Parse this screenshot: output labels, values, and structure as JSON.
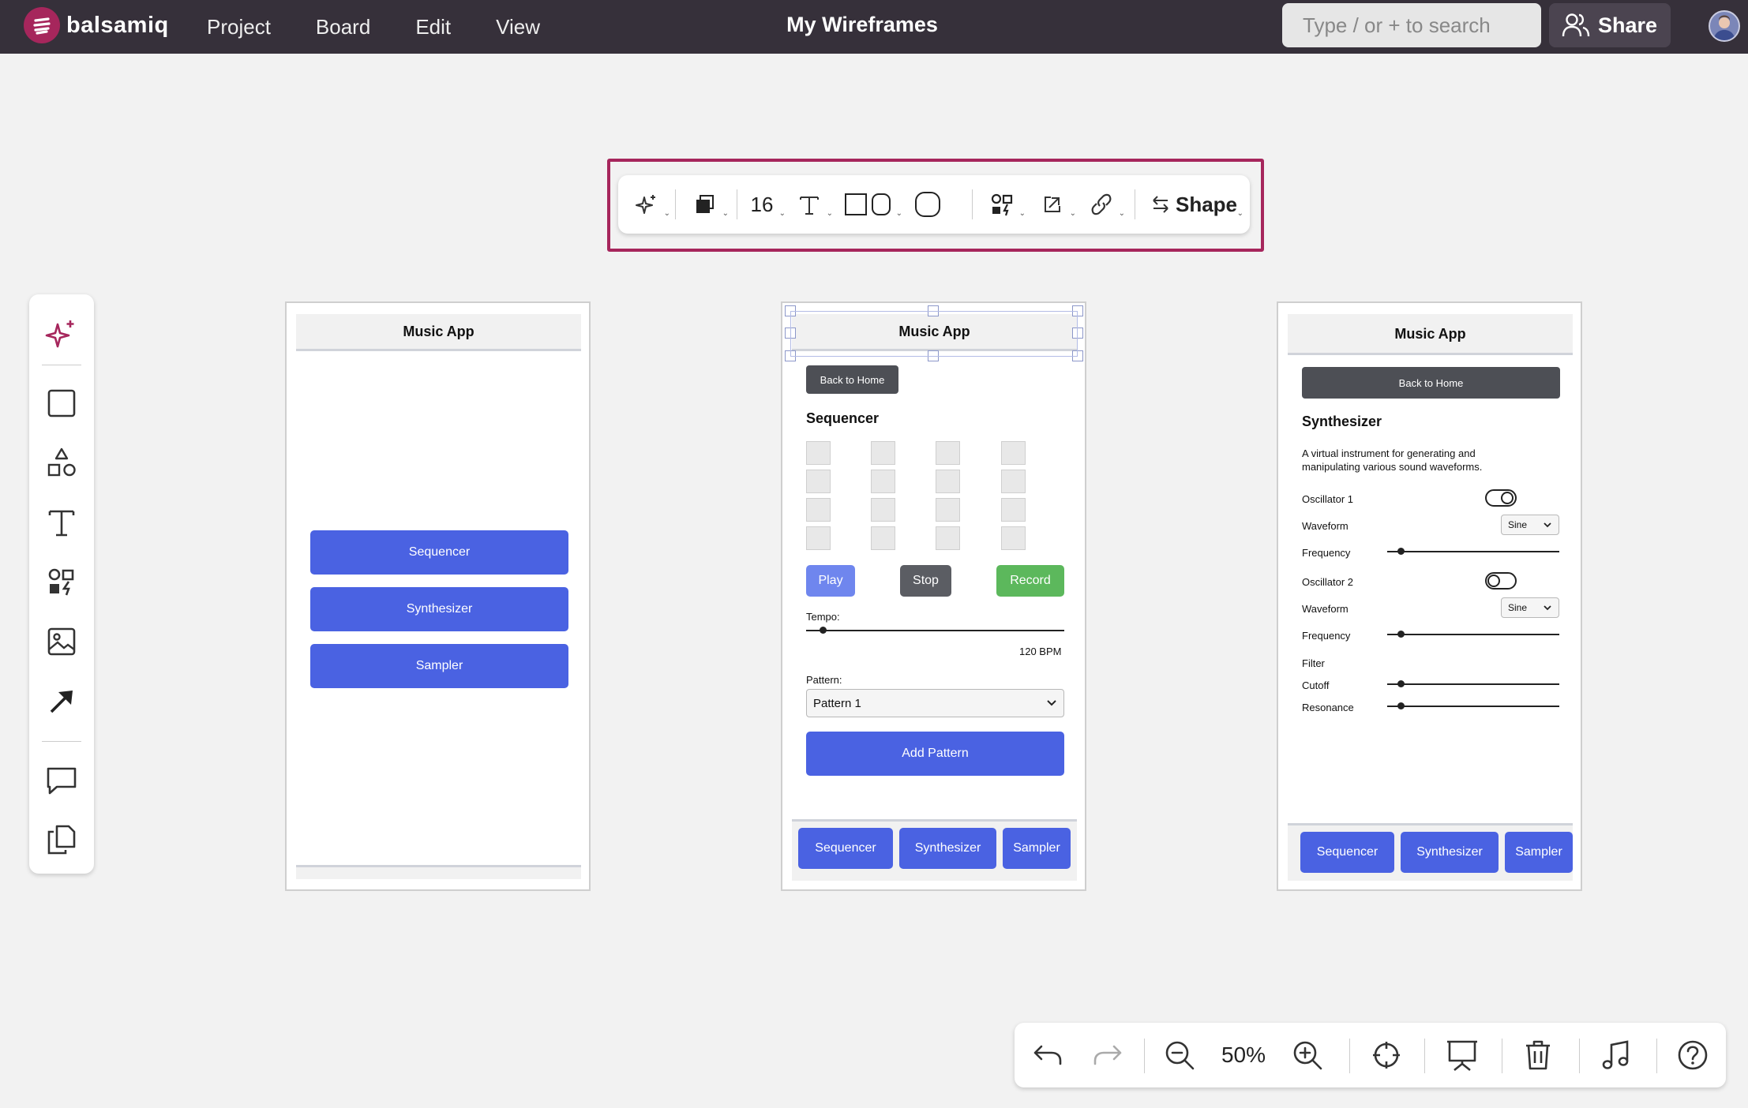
{
  "app": {
    "brand": "balsamiq",
    "document_title": "My Wireframes"
  },
  "menu": [
    "Project",
    "Board",
    "Edit",
    "View"
  ],
  "search": {
    "placeholder": "Type / or + to search"
  },
  "share": {
    "label": "Share"
  },
  "float_toolbar": {
    "font_size": "16",
    "shape_label": "Shape"
  },
  "bottom_toolbar": {
    "zoom": "50%"
  },
  "colors": {
    "topbar": "#36303a",
    "brand": "#a6265c",
    "primary": "#4a62e2",
    "dark_button": "#4d4f55",
    "record": "#5cb85c"
  },
  "frame1": {
    "header": "Music App",
    "buttons": [
      "Sequencer",
      "Synthesizer",
      "Sampler"
    ]
  },
  "frame2": {
    "header": "Music App",
    "back": "Back to Home",
    "title": "Sequencer",
    "play": "Play",
    "stop": "Stop",
    "record": "Record",
    "tempo_label": "Tempo:",
    "tempo_value": "120 BPM",
    "pattern_label": "Pattern:",
    "pattern_value": "Pattern 1",
    "add_pattern": "Add Pattern",
    "tabs": [
      "Sequencer",
      "Synthesizer",
      "Sampler"
    ]
  },
  "frame3": {
    "header": "Music App",
    "back": "Back to Home",
    "title": "Synthesizer",
    "description_line1": "A virtual instrument for generating and",
    "description_line2": "manipulating various sound waveforms.",
    "osc1": "Oscillator 1",
    "osc2": "Oscillator 2",
    "waveform": "Waveform",
    "frequency": "Frequency",
    "waveform_value": "Sine",
    "filter": "Filter",
    "cutoff": "Cutoff",
    "resonance": "Resonance",
    "tabs": [
      "Sequencer",
      "Synthesizer",
      "Sampler"
    ]
  },
  "icons": {
    "float_toolbar": [
      "ai-sparkle-icon",
      "fill-color-icon",
      "text-style-icon",
      "rectangle-shape-icon",
      "rounded-shape-icon",
      "circle-shape-icon",
      "icon-picker-icon",
      "link-external-icon",
      "link-icon",
      "swap-icon"
    ],
    "left_toolbar": [
      "ai-sparkle-icon",
      "rectangle-icon",
      "shapes-icon",
      "text-icon",
      "icons-icon",
      "image-icon",
      "arrow-icon",
      "comment-icon",
      "copy-icon"
    ],
    "bottom_toolbar": [
      "undo-icon",
      "redo-icon",
      "zoom-out-icon",
      "zoom-in-icon",
      "target-icon",
      "presentation-icon",
      "trash-icon",
      "music-note-icon",
      "help-icon"
    ]
  }
}
